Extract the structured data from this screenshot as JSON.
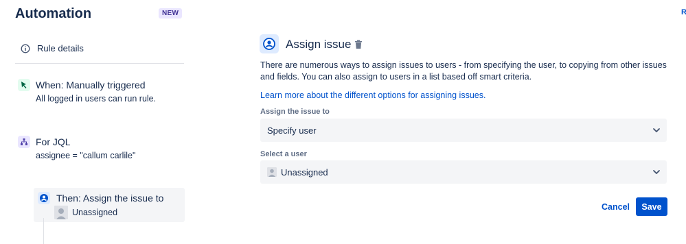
{
  "header": {
    "title": "Automation",
    "badge": "NEW",
    "corner_link": "R"
  },
  "sidebar": {
    "rule_details": {
      "label": "Rule details",
      "icon": "info-icon"
    },
    "steps": [
      {
        "title": "When: Manually triggered",
        "subtitle": "All logged in users can run rule.",
        "icon": "cursor-icon",
        "color": "#006644"
      },
      {
        "title": "For JQL",
        "subtitle": "assignee = \"callum carlile\"",
        "icon": "branch-icon",
        "color": "#5243aa"
      },
      {
        "title": "Then: Assign the issue to",
        "subtitle": "Unassigned",
        "icon": "user-circle-icon",
        "color": "#0052cc"
      }
    ]
  },
  "panel": {
    "title": "Assign issue",
    "description": "There are numerous ways to assign issues to users - from specifying the user, to copying from other issues and fields. You can also assign to users in a list based off smart criteria.",
    "learn_more": "Learn more about the different options for assigning issues.",
    "fields": [
      {
        "label": "Assign the issue to",
        "value": "Specify user"
      },
      {
        "label": "Select a user",
        "value": "Unassigned"
      }
    ],
    "cancel_label": "Cancel",
    "save_label": "Save"
  },
  "colors": {
    "accent": "#0052cc",
    "text": "#172b4d",
    "muted": "#5e6c84",
    "field_bg": "#f4f5f7"
  }
}
